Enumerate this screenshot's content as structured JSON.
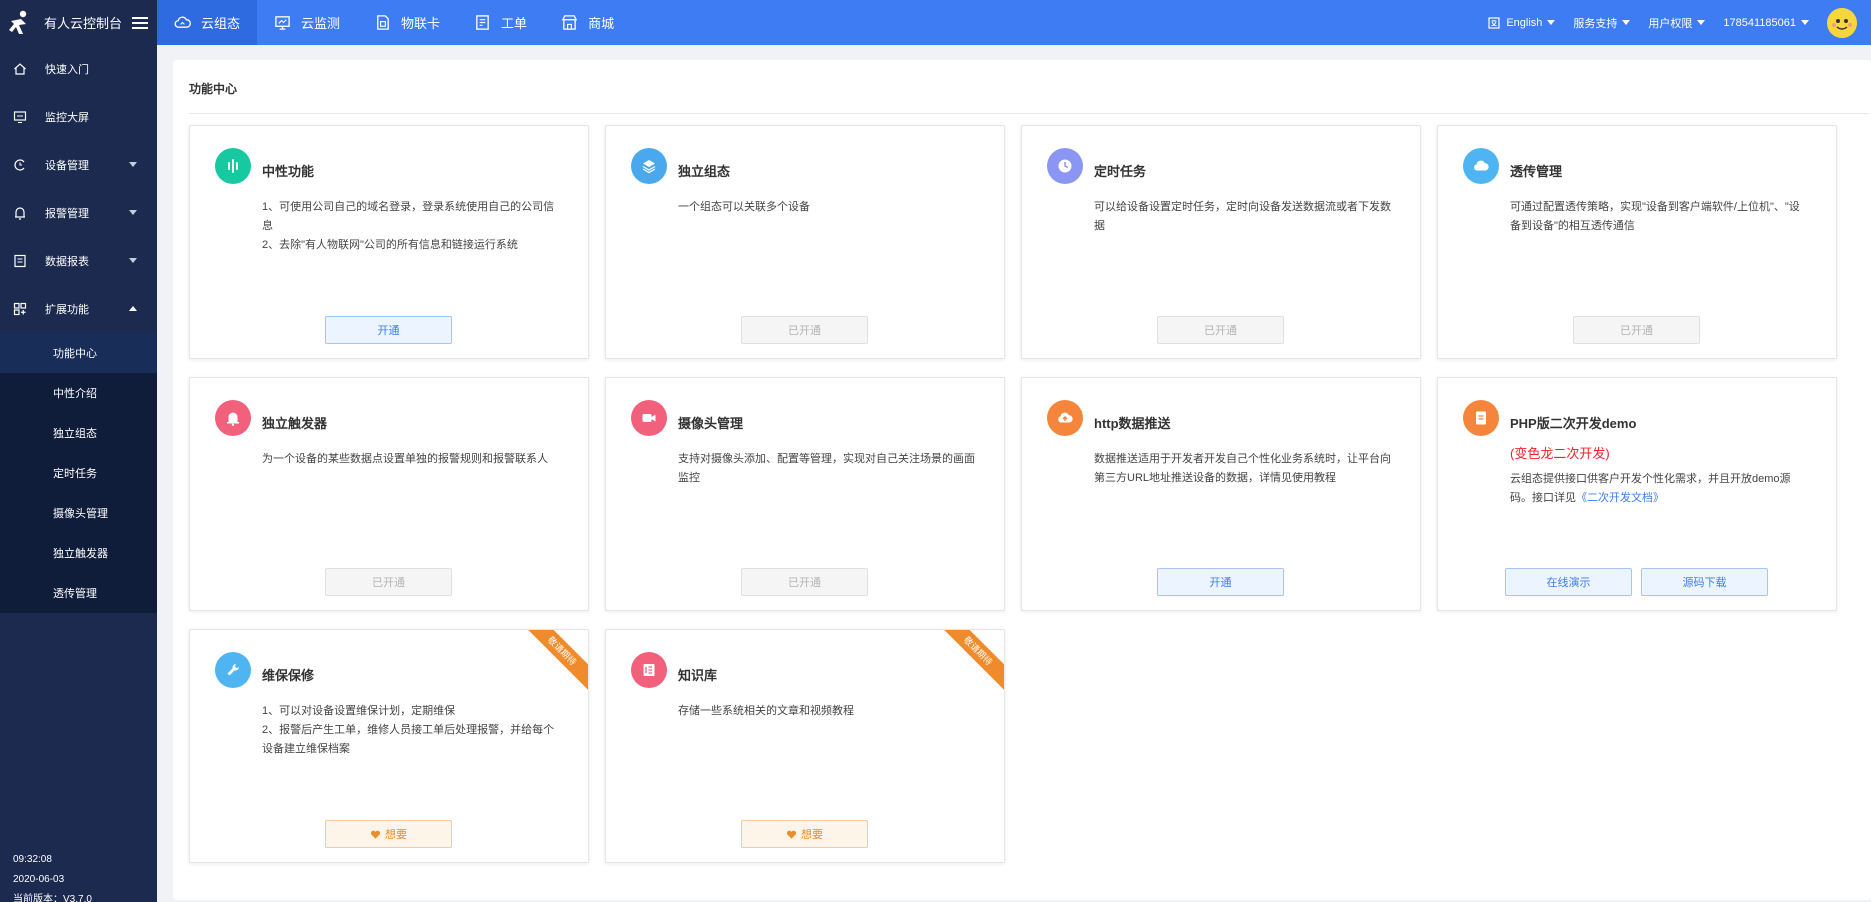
{
  "app": {
    "title": "有人云控制台"
  },
  "nav": [
    {
      "label": "云组态",
      "icon": "cloud-icon",
      "active": true
    },
    {
      "label": "云监测",
      "icon": "monitor-icon"
    },
    {
      "label": "物联卡",
      "icon": "sim-card-icon"
    },
    {
      "label": "工单",
      "icon": "ticket-icon"
    },
    {
      "label": "商城",
      "icon": "shop-icon"
    }
  ],
  "topRight": {
    "language": "English",
    "service": "服务支持",
    "permissions": "用户权限",
    "account": "178541185061"
  },
  "sidebar": {
    "items": [
      {
        "label": "快速入门",
        "icon": "home-icon"
      },
      {
        "label": "监控大屏",
        "icon": "screen-icon"
      },
      {
        "label": "设备管理",
        "icon": "device-icon"
      },
      {
        "label": "报警管理",
        "icon": "alarm-icon"
      },
      {
        "label": "数据报表",
        "icon": "report-icon"
      },
      {
        "label": "扩展功能",
        "icon": "extension-icon"
      }
    ],
    "submenu": [
      "功能中心",
      "中性介绍",
      "独立组态",
      "定时任务",
      "摄像头管理",
      "独立触发器",
      "透传管理"
    ],
    "footer": {
      "time": "09:32:08",
      "date": "2020-06-03",
      "version": "当前版本：V3.7.0"
    }
  },
  "main": {
    "title": "功能中心",
    "cards": [
      {
        "title": "中性功能",
        "line1": "1、可使用公司自己的域名登录，登录系统使用自己的公司信息",
        "line2": "2、去除\"有人物联网\"公司的所有信息和链接运行系统",
        "button": "开通"
      },
      {
        "title": "独立组态",
        "line1": "一个组态可以关联多个设备",
        "button": "已开通"
      },
      {
        "title": "定时任务",
        "line1": "可以给设备设置定时任务，定时向设备发送数据流或者下发数据",
        "button": "已开通"
      },
      {
        "title": "透传管理",
        "line1": "可通过配置透传策略，实现\"设备到客户端软件/上位机\"、\"设备到设备\"的相互透传通信",
        "button": "已开通"
      },
      {
        "title": "独立触发器",
        "line1": "为一个设备的某些数据点设置单独的报警规则和报警联系人",
        "button": "已开通"
      },
      {
        "title": "摄像头管理",
        "line1": "支持对摄像头添加、配置等管理，实现对自己关注场景的画面监控",
        "button": "已开通"
      },
      {
        "title": "http数据推送",
        "line1": "数据推送适用于开发者开发自己个性化业务系统时，让平台向第三方URL地址推送设备的数据，详情见使用教程",
        "button": "开通"
      },
      {
        "title": "PHP版二次开发demo",
        "subtitle": "(变色龙二次开发)",
        "line1": "云组态提供接口供客户开发个性化需求，并且开放demo源码。接口详见",
        "link": "《二次开发文档》",
        "button": "在线演示",
        "button2": "源码下载"
      },
      {
        "title": "维保保修",
        "line1": "1、可以对设备设置维保计划，定期维保",
        "line2": "2、报警后产生工单，维修人员接工单后处理报警，并给每个设备建立维保档案",
        "button": "想要",
        "ribbon": "敬请期待"
      },
      {
        "title": "知识库",
        "line1": "存储一些系统相关的文章和视频教程",
        "button": "想要",
        "ribbon": "敬请期待"
      }
    ]
  },
  "colors": {
    "topbar": "#3d7cf2",
    "sidebar": "#1b2a4e",
    "primary": "#3d7cf2",
    "orange": "#f08b2b",
    "red": "#f5222d"
  }
}
